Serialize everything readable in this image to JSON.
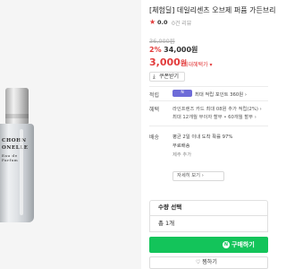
{
  "product": {
    "image": {
      "brand_line1": "CHOHN",
      "brand_line2": "ONELLE",
      "brand_line3": "Eau de Parfum"
    },
    "title": "[체험딜] 데일리센츠 오브제 퍼퓸 가든브리",
    "rating": {
      "star": "★",
      "score": "0.0",
      "review_count": "0건 리뷰"
    },
    "original_price": "36,000원",
    "discount_rate": "2%",
    "discount_price": "34,000원",
    "final_price": "3,000",
    "final_price_unit": "원",
    "coupon_link": "최대혜택가 ▾",
    "coupon_button": "쿠폰받기"
  },
  "info": {
    "points": {
      "label": "적립",
      "badge": "N",
      "text": "최대 적립 포인트 360원 ›"
    },
    "benefits": {
      "label": "혜택",
      "line1": "라인프렌즈 카드 최대 08원 추가 적립(2%) ›",
      "line2": "최대 12개월 무이자 할부 • 60개월 할부 ›"
    },
    "delivery": {
      "label": "배송",
      "line1": "평균 2일 이내 도착 확률 97%",
      "line2": "무료배송",
      "line3": "제주 추가",
      "detail_button": "자세히 보기 ›"
    }
  },
  "purchase": {
    "option_header": "수량 선택",
    "total": "총 1개",
    "buy_label": "구매하기",
    "buy_logo": "N",
    "wish_label": "♡ 찜하기"
  }
}
